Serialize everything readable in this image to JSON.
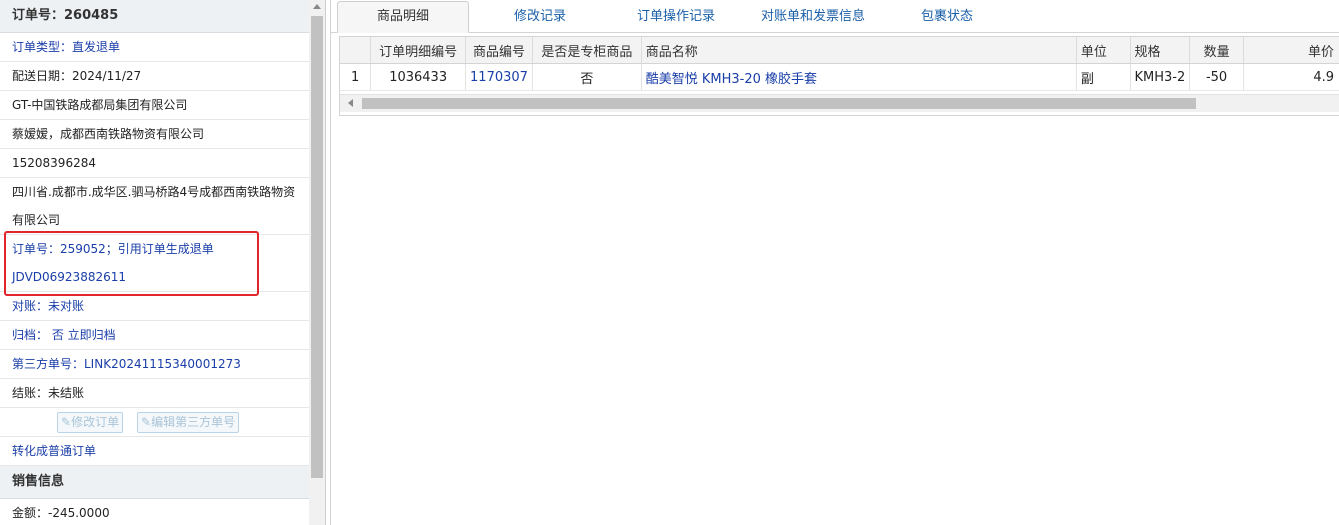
{
  "order": {
    "header": "订单号：260485",
    "type": "订单类型：直发退单",
    "delivery_date": "配送日期：2024/11/27",
    "company": "GT-中国铁路成都局集团有限公司",
    "contact": "蔡嫒嫒，成都西南铁路物资有限公司",
    "phone": "15208396284",
    "address": "四川省.成都市.成华区.驷马桥路4号成都西南铁路物资有限公司",
    "ref_order": "订单号：259052；引用订单生成退单",
    "jd_number": "JDVD06923882611",
    "reconcile": "对账：未对账",
    "archive": "归档： 否 立即归档",
    "third_party": "第三方单号：LINK20241115340001273",
    "settle": "结账：未结账",
    "edit_order_btn": "修改订单",
    "edit_third_btn": "编辑第三方单号",
    "convert_link": "转化成普通订单"
  },
  "sales": {
    "header": "销售信息",
    "amount": "金额：-245.0000"
  },
  "tabs": [
    "商品明细",
    "修改记录",
    "订单操作记录",
    "对账单和发票信息",
    "包裹状态"
  ],
  "table": {
    "columns": [
      "",
      "订单明细编号",
      "商品编号",
      "是否是专柜商品",
      "商品名称",
      "单位",
      "规格",
      "数量",
      "单价"
    ],
    "rows": [
      [
        "1",
        "1036433",
        "1170307",
        "否",
        "酷美智悦 KMH3-20 橡胶手套",
        "副",
        "KMH3-2",
        "-50",
        "4.9"
      ]
    ]
  },
  "colors": {
    "link": "#1a3ea8",
    "highlight": "#e2252b"
  },
  "icons": [
    "edit-icon"
  ]
}
